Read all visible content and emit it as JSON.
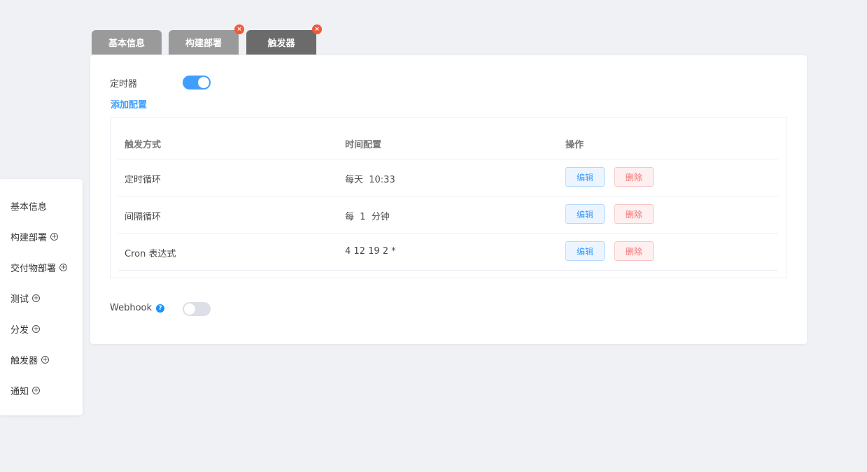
{
  "tabs": [
    {
      "label": "基本信息",
      "closable": false,
      "active": false
    },
    {
      "label": "构建部署",
      "closable": true,
      "active": false
    },
    {
      "label": "触发器",
      "closable": true,
      "active": true
    }
  ],
  "timer": {
    "label": "定时器",
    "enabled": true
  },
  "add_config": "添加配置",
  "table": {
    "headers": [
      "触发方式",
      "时间配置",
      "操作"
    ],
    "rows": [
      {
        "type": "定时循环",
        "time": "每天  10:33",
        "edit": "编辑",
        "delete": "删除"
      },
      {
        "type": "间隔循环",
        "time": "每  1  分钟",
        "edit": "编辑",
        "delete": "删除"
      },
      {
        "type": "Cron 表达式",
        "time": "4 12 19 2 *",
        "edit": "编辑",
        "delete": "删除"
      }
    ]
  },
  "webhook": {
    "label": "Webhook",
    "help_icon": "question-icon",
    "enabled": false
  },
  "sidebar": {
    "items": [
      {
        "label": "基本信息",
        "has_add": false
      },
      {
        "label": "构建部署",
        "has_add": true
      },
      {
        "label": "交付物部署",
        "has_add": true
      },
      {
        "label": "测试",
        "has_add": true
      },
      {
        "label": "分发",
        "has_add": true
      },
      {
        "label": "触发器",
        "has_add": true
      },
      {
        "label": "通知",
        "has_add": true
      }
    ]
  },
  "colors": {
    "accent": "#409eff",
    "danger": "#f56c6c",
    "tab_inactive": "#9a9a9a",
    "tab_active": "#6b6b6b",
    "tab_close": "#ef5a3c",
    "background": "#f0f1f5"
  }
}
